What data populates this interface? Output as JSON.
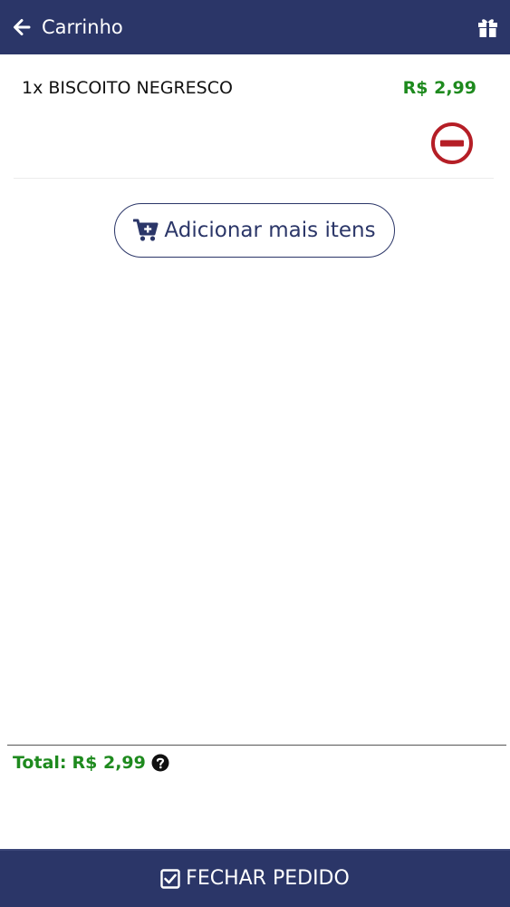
{
  "header": {
    "title": "Carrinho",
    "back_icon": "arrow-left-icon",
    "gift_icon": "gift-icon"
  },
  "cart": {
    "items": [
      {
        "name": "1x BISCOITO NEGRESCO",
        "price": "R$ 2,99",
        "remove_icon": "minus-circle-icon"
      }
    ]
  },
  "actions": {
    "add_more_label": "Adicionar mais itens",
    "add_more_icon": "cart-plus-icon"
  },
  "summary": {
    "total_label": "Total:",
    "total_value": "R$ 2,99",
    "help_icon": "question-circle-icon"
  },
  "checkout": {
    "label": "FECHAR PEDIDO",
    "icon": "check-square-icon"
  },
  "colors": {
    "header_bg": "#2b3668",
    "price_green": "#1e8a1e",
    "remove_red": "#b51e26",
    "text_dark": "#111111"
  }
}
